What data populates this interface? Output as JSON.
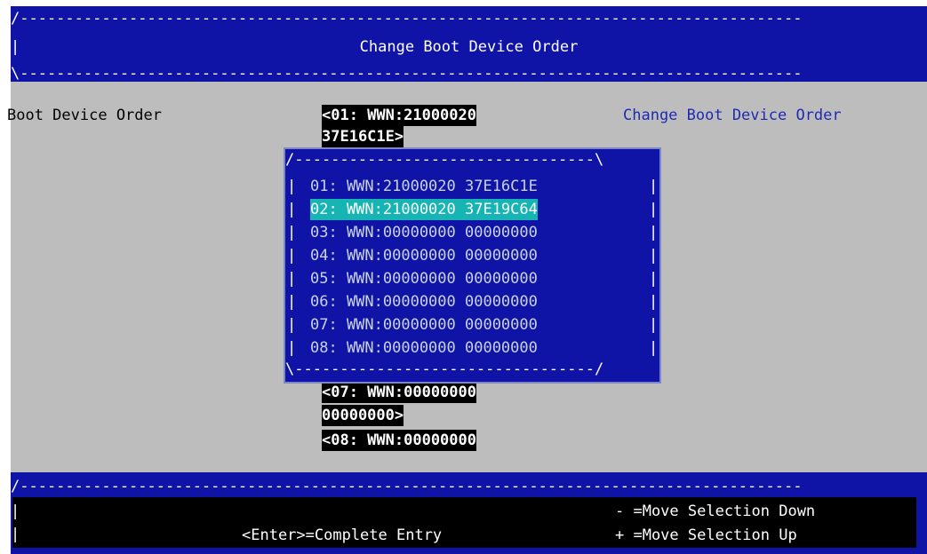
{
  "header": {
    "title": "Change Boot Device Order",
    "dash_top": "/--------------------------------------------------------------------------------------",
    "bar": "|",
    "dash_bottom": "\\--------------------------------------------------------------------------------------"
  },
  "form": {
    "field_label": "Boot Device Order",
    "help_title": "Change Boot Device Order",
    "field_values": [
      "<01: WWN:21000020",
      "37E16C1E>",
      "<07: WWN:00000000",
      "00000000>",
      "<08: WWN:00000000"
    ]
  },
  "popup": {
    "top_border": "/---------------------------------\\",
    "bottom_border": "\\---------------------------------/",
    "bar": "|",
    "items": [
      "01: WWN:21000020 37E16C1E",
      "02: WWN:21000020 37E19C64",
      "03: WWN:00000000 00000000",
      "04: WWN:00000000 00000000",
      "05: WWN:00000000 00000000",
      "06: WWN:00000000 00000000",
      "07: WWN:00000000 00000000",
      "08: WWN:00000000 00000000"
    ],
    "selected_index": 1
  },
  "footer": {
    "dash_top": "/--------------------------------------------------------------------------------------",
    "bar": "|",
    "enter_hint": "<Enter>=Complete Entry",
    "minus_hint": "- =Move Selection Down",
    "plus_hint": "+ =Move Selection Up"
  },
  "colors": {
    "bios_blue": "#0f14a6",
    "panel_gray": "#bdbdbd",
    "highlight_cyan": "#17b4b4",
    "help_blue": "#1f2ab3"
  }
}
